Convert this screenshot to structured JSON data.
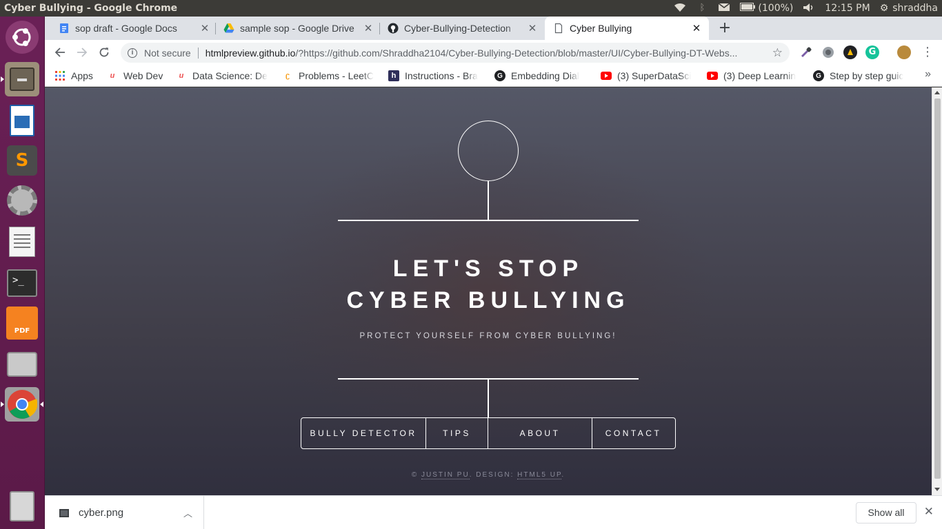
{
  "system": {
    "window_title": "Cyber Bullying - Google Chrome",
    "battery": "(100%)",
    "time": "12:15 PM",
    "user": "shraddha"
  },
  "tabs": [
    {
      "title": "sop draft - Google Docs",
      "icon": "google-docs-icon"
    },
    {
      "title": "sample sop - Google Drive",
      "icon": "google-drive-icon"
    },
    {
      "title": "Cyber-Bullying-Detection",
      "icon": "github-icon"
    },
    {
      "title": "Cyber Bullying",
      "icon": "page-icon",
      "active": true
    }
  ],
  "toolbar": {
    "security_label": "Not secure",
    "url_host": "htmlpreview.github.io",
    "url_rest": "/?https://github.com/Shraddha2104/Cyber-Bullying-Detection/blob/master/UI/Cyber-Bullying-DT-Webs..."
  },
  "bookmarks": [
    {
      "label": "Apps",
      "icon": "apps-grid-icon"
    },
    {
      "label": "Web Dev",
      "icon": "udemy-icon"
    },
    {
      "label": "Data Science: De",
      "icon": "udemy-icon"
    },
    {
      "label": "Problems - LeetC",
      "icon": "leetcode-icon"
    },
    {
      "label": "Instructions - Bra",
      "icon": "hackerrank-icon"
    },
    {
      "label": "Embedding Dial",
      "icon": "github-icon"
    },
    {
      "label": "(3) SuperDataSci",
      "icon": "youtube-icon"
    },
    {
      "label": "(3) Deep Learnin",
      "icon": "youtube-icon"
    },
    {
      "label": "Step by step guic",
      "icon": "github-icon"
    }
  ],
  "page": {
    "headline_line1": "LET'S STOP",
    "headline_line2": "CYBER BULLYING",
    "tagline": "PROTECT YOURSELF FROM CYBER BULLYING!",
    "nav": [
      "BULLY DETECTOR",
      "TIPS",
      "ABOUT",
      "CONTACT"
    ],
    "footer_prefix": "© ",
    "footer_author": "JUSTIN PU",
    "footer_mid": ". DESIGN: ",
    "footer_design": "HTML5 UP",
    "footer_end": "."
  },
  "downloads": {
    "file_name": "cyber.png",
    "show_all_label": "Show all"
  },
  "colors": {
    "launcher": "#6a2056",
    "tabstrip": "#dee1e6",
    "page_text": "#ffffff"
  }
}
